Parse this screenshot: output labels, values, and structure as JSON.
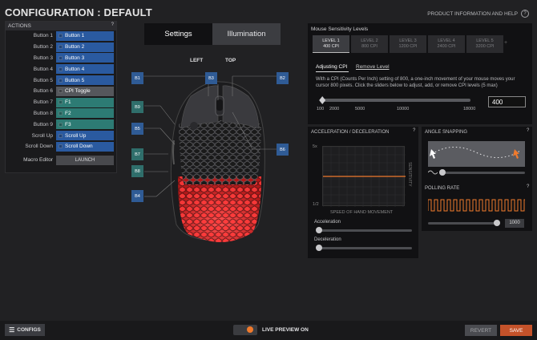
{
  "header": {
    "title": "CONFIGURATION : DEFAULT",
    "product_link": "PRODUCT INFORMATION AND HELP",
    "product_link_icon": "?"
  },
  "actions": {
    "title": "ACTIONS",
    "help_icon": "?",
    "rows": [
      {
        "label": "Button 1",
        "value": "Button 1",
        "color": "blue"
      },
      {
        "label": "Button 2",
        "value": "Button 2",
        "color": "blue"
      },
      {
        "label": "Button 3",
        "value": "Button 3",
        "color": "blue"
      },
      {
        "label": "Button 4",
        "value": "Button 4",
        "color": "blue"
      },
      {
        "label": "Button 5",
        "value": "Button 5",
        "color": "blue"
      },
      {
        "label": "Button 6",
        "value": "CPI Toggle",
        "color": "gray"
      },
      {
        "label": "Button 7",
        "value": "F1",
        "color": "teal"
      },
      {
        "label": "Button 8",
        "value": "F2",
        "color": "teal"
      },
      {
        "label": "Button 9",
        "value": "F3",
        "color": "teal"
      },
      {
        "label": "Scroll Up",
        "value": "Scroll Up",
        "color": "blue"
      },
      {
        "label": "Scroll Down",
        "value": "Scroll Down",
        "color": "blue"
      }
    ],
    "macro_label": "Macro Editor",
    "launch_label": "LAUNCH"
  },
  "tabs": {
    "settings": "Settings",
    "illumination": "Illumination"
  },
  "mouse": {
    "left_label": "LEFT",
    "top_label": "TOP",
    "buttons": [
      "B1",
      "B2",
      "B3",
      "B4",
      "B5",
      "B6",
      "B7",
      "B8",
      "B9"
    ]
  },
  "sensitivity": {
    "title": "Mouse Sensitivity Levels",
    "levels": [
      {
        "level": "LEVEL 1",
        "cpi": "400 CPI",
        "active": true
      },
      {
        "level": "LEVEL 2",
        "cpi": "800 CPI",
        "active": false
      },
      {
        "level": "LEVEL 3",
        "cpi": "1200 CPI",
        "active": false
      },
      {
        "level": "LEVEL 4",
        "cpi": "2400 CPI",
        "active": false
      },
      {
        "level": "LEVEL 5",
        "cpi": "3200 CPI",
        "active": false
      }
    ],
    "add_icon": "+",
    "subtab_adjust": "Adjusting CPI",
    "subtab_remove": "Remove Level",
    "description": "With a CPI (Counts Per Inch) setting of 800, a one-inch movement of your mouse moves your cursor 800 pixels. Click the sliders below to adjust, add, or remove CPI levels (5 max)",
    "ticks": [
      "100",
      "2000",
      "5000",
      "10000",
      "18000"
    ],
    "cpi_value": "400",
    "cpi_fraction": 0.017
  },
  "accel": {
    "title": "ACCELERATION / DECELERATION",
    "help_icon": "?",
    "y_top": "5x",
    "y_bottom": "1/2",
    "side_label": "SENSITIVITY",
    "x_label": "SPEED OF HAND MOVEMENT",
    "accel_label": "Acceleration",
    "decel_label": "Deceleration"
  },
  "angle": {
    "title": "ANGLE SNAPPING",
    "help_icon": "?"
  },
  "polling": {
    "title": "POLLING RATE",
    "help_icon": "?",
    "value": "1000"
  },
  "footer": {
    "configs": "CONFIGS",
    "live_preview": "LIVE PREVIEW ON",
    "revert": "REVERT",
    "save": "SAVE"
  },
  "colors": {
    "accent": "#f07a2c",
    "save": "#c4522a",
    "blue": "#2a5aa0",
    "teal": "#2d7b74"
  }
}
